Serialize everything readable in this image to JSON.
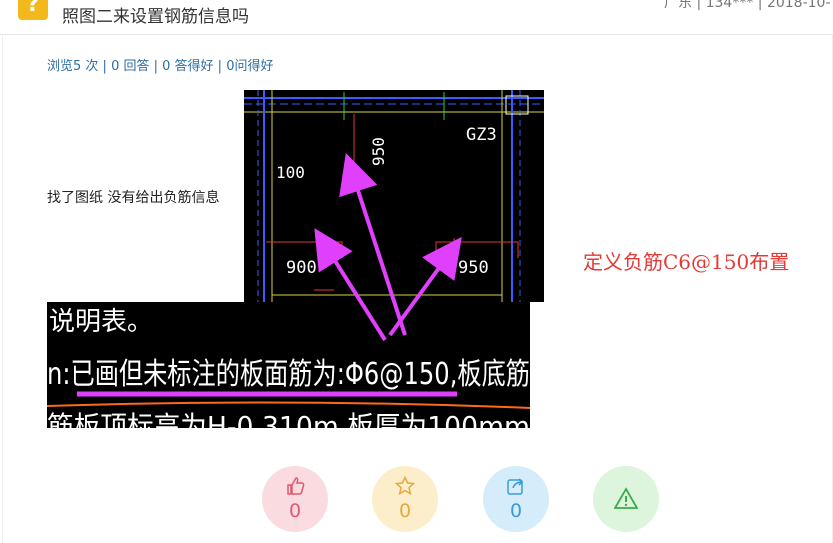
{
  "header": {
    "badge": "?",
    "title_line2": "照图二来设置钢筋信息吗",
    "meta": "广东 | 134*** | 2018-10-"
  },
  "stats": {
    "views": "浏览5 次",
    "answers": "0 回答",
    "good_answers": "0 答得好",
    "good_questions": "0问得好"
  },
  "body_text": "找了图纸 没有给出负筋信息",
  "cad_image_1": {
    "labels": [
      "GZ3",
      "950",
      "100",
      "900",
      "950"
    ]
  },
  "cad_image_2": {
    "line1": "说明表。",
    "line2": "n:已画但未标注的板面筋为:Φ6@150,板底筋",
    "line3": "筋板顶标高为H-0.310m,板厚为100mm"
  },
  "annotation": "定义负筋C6@150布置",
  "actions": {
    "like_count": "0",
    "favorite_count": "0",
    "share_count": "0"
  },
  "colors": {
    "accent_link": "#2e6da4",
    "annotation": "#e53935",
    "arrow": "#e040fb"
  }
}
